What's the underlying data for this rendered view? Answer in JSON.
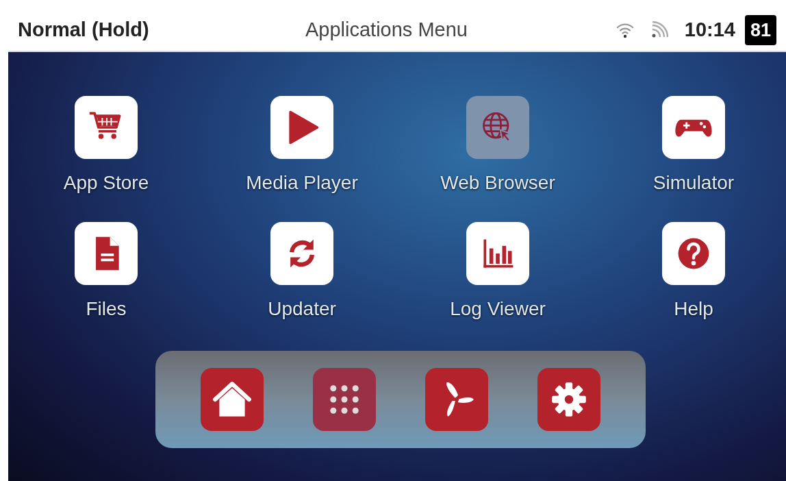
{
  "status_bar": {
    "mode": "Normal (Hold)",
    "title": "Applications Menu",
    "time": "10:14",
    "battery": "81"
  },
  "apps": [
    {
      "label": "App Store",
      "kind": "cart",
      "selected": false
    },
    {
      "label": "Media Player",
      "kind": "play",
      "selected": false
    },
    {
      "label": "Web Browser",
      "kind": "globe",
      "selected": true
    },
    {
      "label": "Simulator",
      "kind": "gamepad",
      "selected": false
    },
    {
      "label": "Files",
      "kind": "file",
      "selected": false
    },
    {
      "label": "Updater",
      "kind": "sync",
      "selected": false
    },
    {
      "label": "Log Viewer",
      "kind": "chart",
      "selected": false
    },
    {
      "label": "Help",
      "kind": "help",
      "selected": false
    }
  ],
  "dock": [
    {
      "kind": "home",
      "selected": false
    },
    {
      "kind": "grid",
      "selected": true
    },
    {
      "kind": "fan",
      "selected": false
    },
    {
      "kind": "gear",
      "selected": false
    }
  ]
}
